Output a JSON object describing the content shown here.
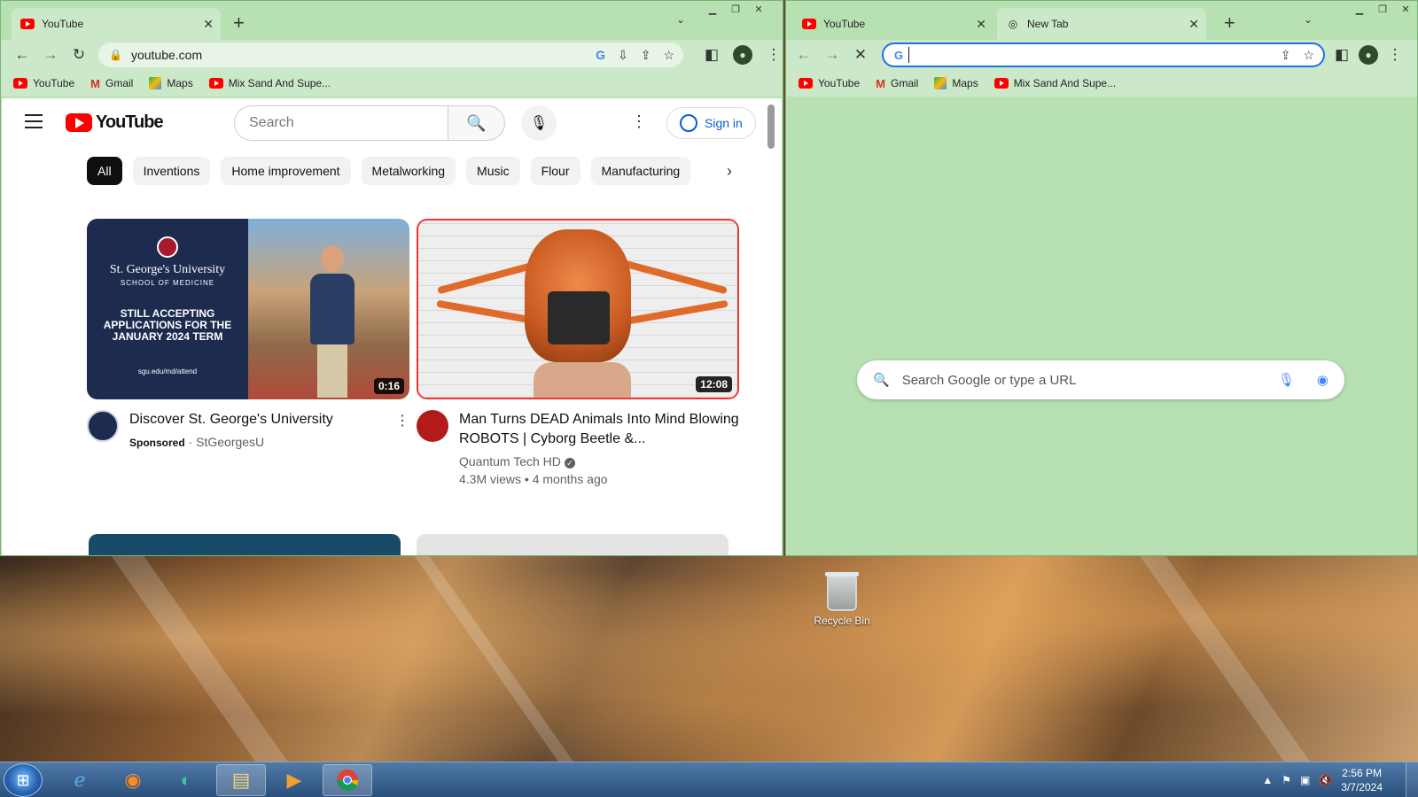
{
  "left_window": {
    "tab": {
      "title": "YouTube"
    },
    "address": "youtube.com",
    "bookmarks": [
      {
        "label": "YouTube",
        "icon": "youtube-icon"
      },
      {
        "label": "Gmail",
        "icon": "gmail-icon"
      },
      {
        "label": "Maps",
        "icon": "maps-icon"
      },
      {
        "label": "Mix Sand And Supe...",
        "icon": "youtube-icon"
      }
    ],
    "youtube": {
      "logo_text": "YouTube",
      "search_placeholder": "Search",
      "sign_in": "Sign in",
      "chips": [
        "All",
        "Inventions",
        "Home improvement",
        "Metalworking",
        "Music",
        "Flour",
        "Manufacturing"
      ],
      "videos": [
        {
          "title": "Discover St. George's University",
          "sponsored": "Sponsored",
          "channel": "StGeorgesU",
          "duration": "0:16",
          "thumb_text": {
            "school": "St. George's University",
            "school_sub": "SCHOOL OF MEDICINE",
            "message": "STILL ACCEPTING APPLICATIONS FOR THE JANUARY 2024 TERM",
            "url": "sgu.edu/md/attend"
          }
        },
        {
          "title": "Man Turns DEAD Animals Into Mind Blowing ROBOTS | Cyborg Beetle &...",
          "channel": "Quantum Tech HD",
          "stats": "4.3M views • 4 months ago",
          "duration": "12:08"
        }
      ]
    }
  },
  "right_window": {
    "tabs": [
      {
        "title": "YouTube"
      },
      {
        "title": "New Tab"
      }
    ],
    "address": "",
    "bookmarks": [
      {
        "label": "YouTube",
        "icon": "youtube-icon"
      },
      {
        "label": "Gmail",
        "icon": "gmail-icon"
      },
      {
        "label": "Maps",
        "icon": "maps-icon"
      },
      {
        "label": "Mix Sand And Supe...",
        "icon": "youtube-icon"
      }
    ],
    "ntp_search_placeholder": "Search Google or type a URL"
  },
  "desktop": {
    "recycle_bin": "Recycle Bin"
  },
  "taskbar": {
    "apps": [
      "start-icon",
      "internet-explorer-icon",
      "firefox-icon",
      "edge-icon",
      "file-explorer-icon",
      "media-player-icon",
      "chrome-icon"
    ],
    "time": "2:56 PM",
    "date": "3/7/2024"
  },
  "colors": {
    "chrome_frame": "#b7e1b3",
    "chrome_toolbar": "#cbe8c8",
    "youtube_red": "#ff0000",
    "taskbar": "#2a4f7c"
  }
}
